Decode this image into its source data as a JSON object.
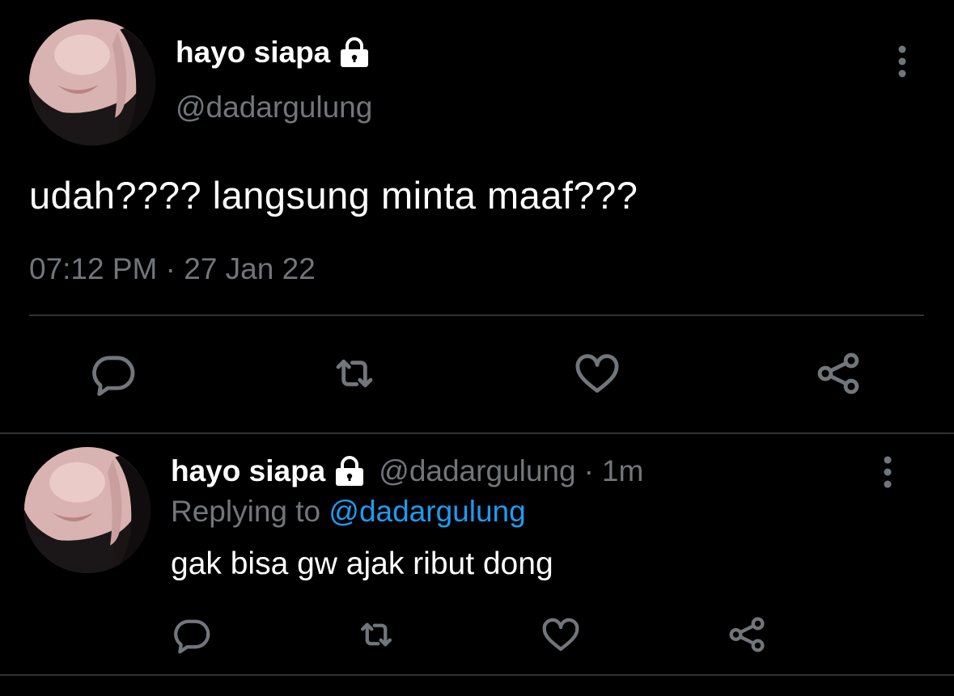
{
  "main_tweet": {
    "display_name": "hayo siapa",
    "handle": "@dadargulung",
    "text": "udah???? langsung minta maaf???",
    "timestamp": "07:12 PM · 27 Jan 22",
    "protected_icon": "lock-icon",
    "more_icon": "more-vertical-icon",
    "actions": [
      "reply-icon",
      "retweet-icon",
      "like-icon",
      "share-icon"
    ]
  },
  "reply_tweet": {
    "display_name": "hayo siapa",
    "handle": "@dadargulung",
    "separator": "·",
    "time_ago": "1m",
    "replying_prefix": "Replying to",
    "replying_to": "@dadargulung",
    "text": "gak bisa gw ajak ribut dong",
    "protected_icon": "lock-icon",
    "more_icon": "more-vertical-icon",
    "actions": [
      "reply-icon",
      "retweet-icon",
      "like-icon",
      "share-icon"
    ]
  },
  "colors": {
    "background": "#000000",
    "primary_text": "#ffffff",
    "secondary_text": "#71767b",
    "link": "#1d9bf0",
    "divider": "#2f3336"
  }
}
